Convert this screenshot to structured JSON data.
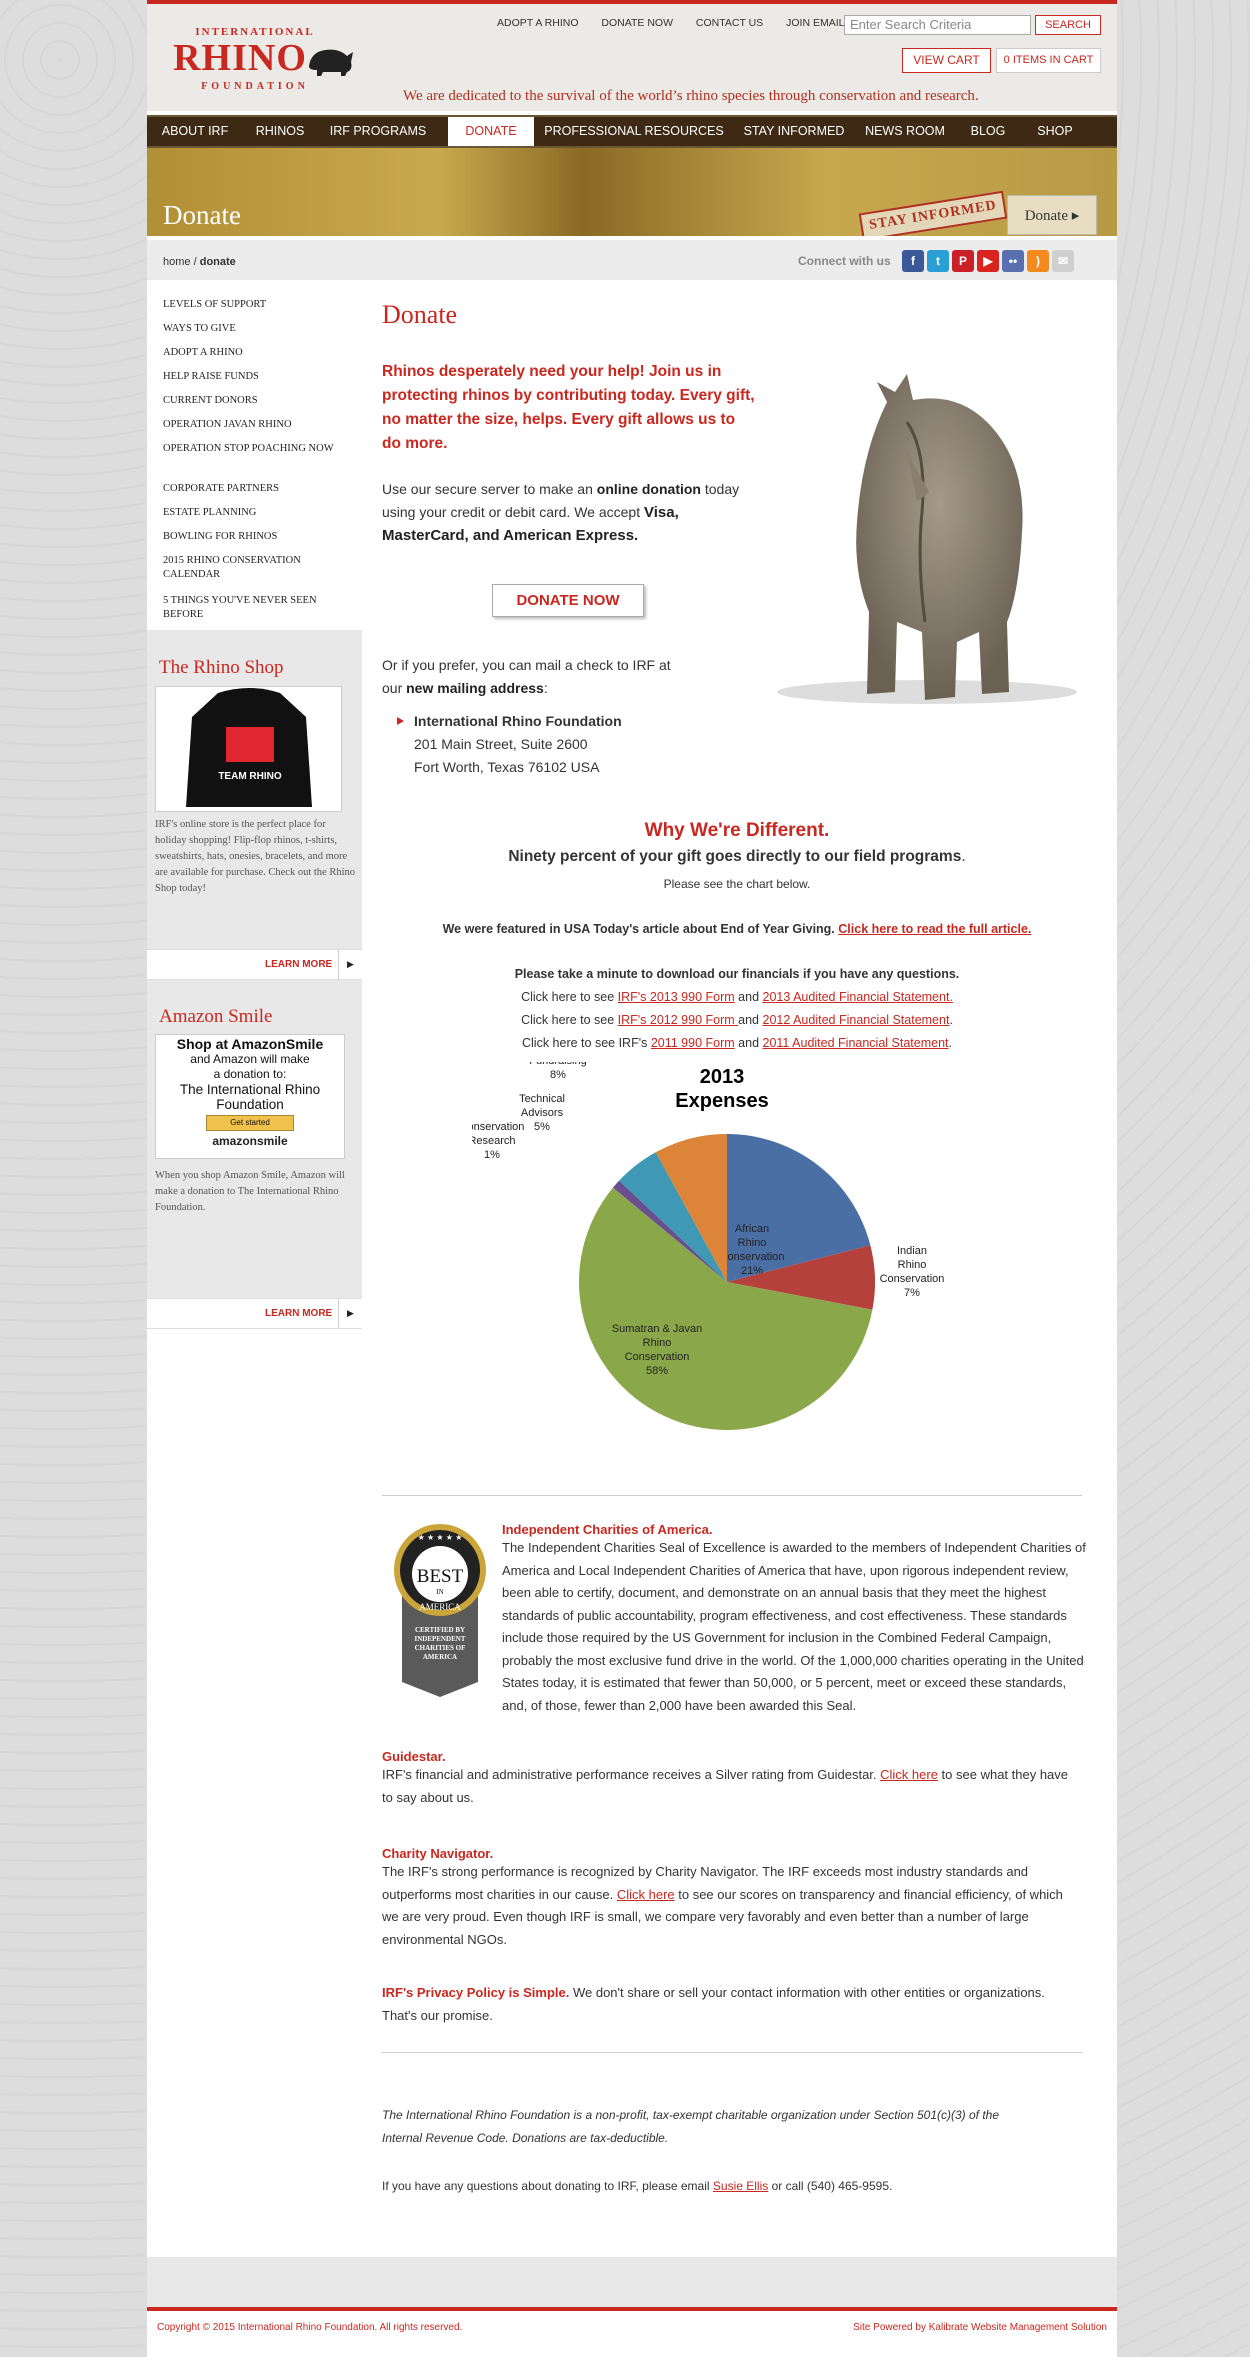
{
  "header": {
    "logo_top": "INTERNATIONAL",
    "logo_main": "RHINO",
    "logo_bottom": "FOUNDATION",
    "toplinks": [
      "ADOPT A RHINO",
      "DONATE NOW",
      "CONTACT US",
      "JOIN EMAIL LIST"
    ],
    "search_placeholder": "Enter Search Criteria",
    "search_button": "SEARCH",
    "view_cart": "VIEW CART",
    "items_in_cart": "0 ITEMS IN CART",
    "tagline": "We are dedicated to the survival of the world’s rhino species through conservation and research."
  },
  "nav": [
    "ABOUT IRF",
    "RHINOS",
    "IRF PROGRAMS",
    "DONATE",
    "PROFESSIONAL RESOURCES",
    "STAY INFORMED",
    "NEWS ROOM",
    "BLOG",
    "SHOP"
  ],
  "banner": {
    "title": "Donate",
    "stay_label": "STAY INFORMED",
    "donate_tab": "Donate ▸"
  },
  "breadcrumb": {
    "home": "home",
    "sep": "/",
    "current": "donate"
  },
  "connect": "Connect with us",
  "social": [
    {
      "name": "facebook",
      "glyph": "f",
      "color": "#3b5998"
    },
    {
      "name": "twitter",
      "glyph": "t",
      "color": "#2a9fd6"
    },
    {
      "name": "pinterest",
      "glyph": "P",
      "color": "#cb2027"
    },
    {
      "name": "youtube",
      "glyph": "▶",
      "color": "#d9251d"
    },
    {
      "name": "flickr",
      "glyph": "••",
      "color": "#5a6fb0"
    },
    {
      "name": "rss",
      "glyph": ")",
      "color": "#f28a1e"
    },
    {
      "name": "email",
      "glyph": "✉",
      "color": "#cfcfcf"
    }
  ],
  "sidebar": {
    "items": [
      "LEVELS OF SUPPORT",
      "WAYS TO GIVE",
      "ADOPT A RHINO",
      "HELP RAISE FUNDS",
      "CURRENT DONORS",
      "OPERATION JAVAN RHINO",
      "OPERATION STOP POACHING NOW",
      "CORPORATE PARTNERS",
      "ESTATE PLANNING",
      "BOWLING FOR RHINOS",
      "2015 RHINO CONSERVATION CALENDAR",
      "5 THINGS YOU'VE NEVER SEEN BEFORE"
    ],
    "shop_title": "The Rhino Shop",
    "shop_hoodie_text": "TEAM RHINO",
    "shop_text": "IRF's online store is the perfect place for holiday shopping!  Flip-flop rhinos, t-shirts, sweatshirts, hats, onesies, bracelets, and more are available for purchase. Check out the Rhino Shop today!",
    "learn_more": "LEARN MORE",
    "amazon_title": "Amazon Smile",
    "amazon_box_1": "Shop at AmazonSmile",
    "amazon_box_2": "and Amazon will make",
    "amazon_box_3": "a donation to:",
    "amazon_box_4": "The International Rhino Foundation",
    "amazon_get_started": "Get started",
    "amazon_logo": "amazonsmile",
    "amazon_text": "When you shop Amazon Smile, Amazon will make a donation to The International Rhino Foundation."
  },
  "main": {
    "title": "Donate",
    "lead": "Rhinos desperately need your help! Join us in protecting rhinos by contributing today. Every gift, no matter the size, helps.  Every gift allows us to do more.",
    "p1_a": "Use our secure server to make an ",
    "p1_b": "online donation",
    "p1_c": " today using your credit or debit card. We accept ",
    "p1_d": "Visa, MasterCard, and American Express.",
    "donate_now": "DONATE NOW",
    "p2_a": "Or if you prefer, you can mail a check to IRF at our ",
    "p2_b": "new mailing address",
    "p2_c": ":",
    "addr_name": "International Rhino Foundation",
    "addr_1": "201 Main Street, Suite 2600",
    "addr_2": "Fort Worth, Texas 76102  USA",
    "why": "Why We're Different.",
    "ninety": "Ninety percent of your gift goes directly to our field programs",
    "ninety_dot": ".",
    "see_chart": "Please see the chart below.",
    "featured": "We were featured in USA Today's article about End of Year Giving. ",
    "featured_link": "Click here to read the full article.",
    "fin_title": "Please take a minute to download our financials if you have any questions.",
    "fin_rows": [
      {
        "pre": "Click here to see ",
        "a": "IRF's 2013 990 Form",
        "mid": " and ",
        "b": "2013 Audited Financial Statement.",
        "post": ""
      },
      {
        "pre": "Click here to see ",
        "a": "IRF's 2012 990 Form ",
        "mid": " and ",
        "b": "2012 Audited Financial Statement",
        "post": "."
      },
      {
        "pre": "Click here to see IRF's ",
        "a": "2011 990 Form",
        "mid": " and ",
        "b": "2011 Audited Financial Statement",
        "post": "."
      }
    ],
    "ica_title": "Independent Charities of America.",
    "ica_text": "The Independent Charities Seal of Excellence is awarded to the members of Independent Charities of America and Local Independent Charities of America that have, upon rigorous independent review, been able to certify, document, and demonstrate on an annual basis that they meet the highest standards of public accountability, program effectiveness, and cost effectiveness. These standards include those required by the US Government for inclusion in the Combined Federal Campaign, probably the most exclusive fund drive in the world. Of the 1,000,000 charities operating in the United States today, it is estimated that fewer than 50,000,  or 5 percent, meet or exceed these standards, and, of those, fewer than 2,000 have been awarded this Seal.",
    "seal_best": "BEST",
    "seal_in": "IN",
    "seal_america": "AMERICA",
    "seal_certified": "CERTIFIED BY INDEPENDENT CHARITIES OF AMERICA",
    "guide_title": "Guidestar.",
    "guide_text_a": "IRF's financial and administrative performance receives a Silver rating from Guidestar.  ",
    "guide_link": "Click here",
    "guide_text_b": " to see what they have to say about us.",
    "cn_title": "Charity Navigator.",
    "cn_text_a": "The IRF's strong performance is recognized by Charity Navigator. The IRF exceeds most industry standards and outperforms most charities in our cause.  ",
    "cn_link": "Click here",
    "cn_text_b": " to see our scores on transparency and financial efficiency, of which we are very proud.  Even though IRF is small, we compare very favorably and even better than a number of large environmental NGOs.",
    "privacy_title": "IRF's Privacy Policy is Simple.",
    "privacy_text": "  We don't share or sell your contact information with other entities or organizations. That's our promise.",
    "nonprofit": "The International Rhino Foundation is a non-profit, tax-exempt charitable organization under Section 501(c)(3) of the Internal Revenue Code. Donations are tax-deductible.",
    "questions_a": "If you have any questions about donating to IRF, please email ",
    "questions_link": "Susie Ellis",
    "questions_b": " or call (540) 465-9595."
  },
  "chart_data": {
    "type": "pie",
    "title": "2013 Expenses",
    "categories": [
      "African Rhino Conservation",
      "Indian Rhino Conservation",
      "Sumatran & Javan Rhino Conservation",
      "Conservation Research",
      "Technical Advisors",
      "Administration & Fundraising"
    ],
    "values": [
      21,
      7,
      58,
      1,
      5,
      8
    ],
    "labels": [
      "21%",
      "7%",
      "58%",
      "1%",
      "5%",
      "8%"
    ],
    "colors": [
      "#4a6fa5",
      "#b5413d",
      "#8aa84a",
      "#6a4f90",
      "#3f99b5",
      "#dc8437"
    ]
  },
  "footer": {
    "copyright": "Copyright © 2015 International Rhino Foundation. All rights reserved.",
    "powered": "Site Powered by Kalibrate Website Management Solution"
  }
}
